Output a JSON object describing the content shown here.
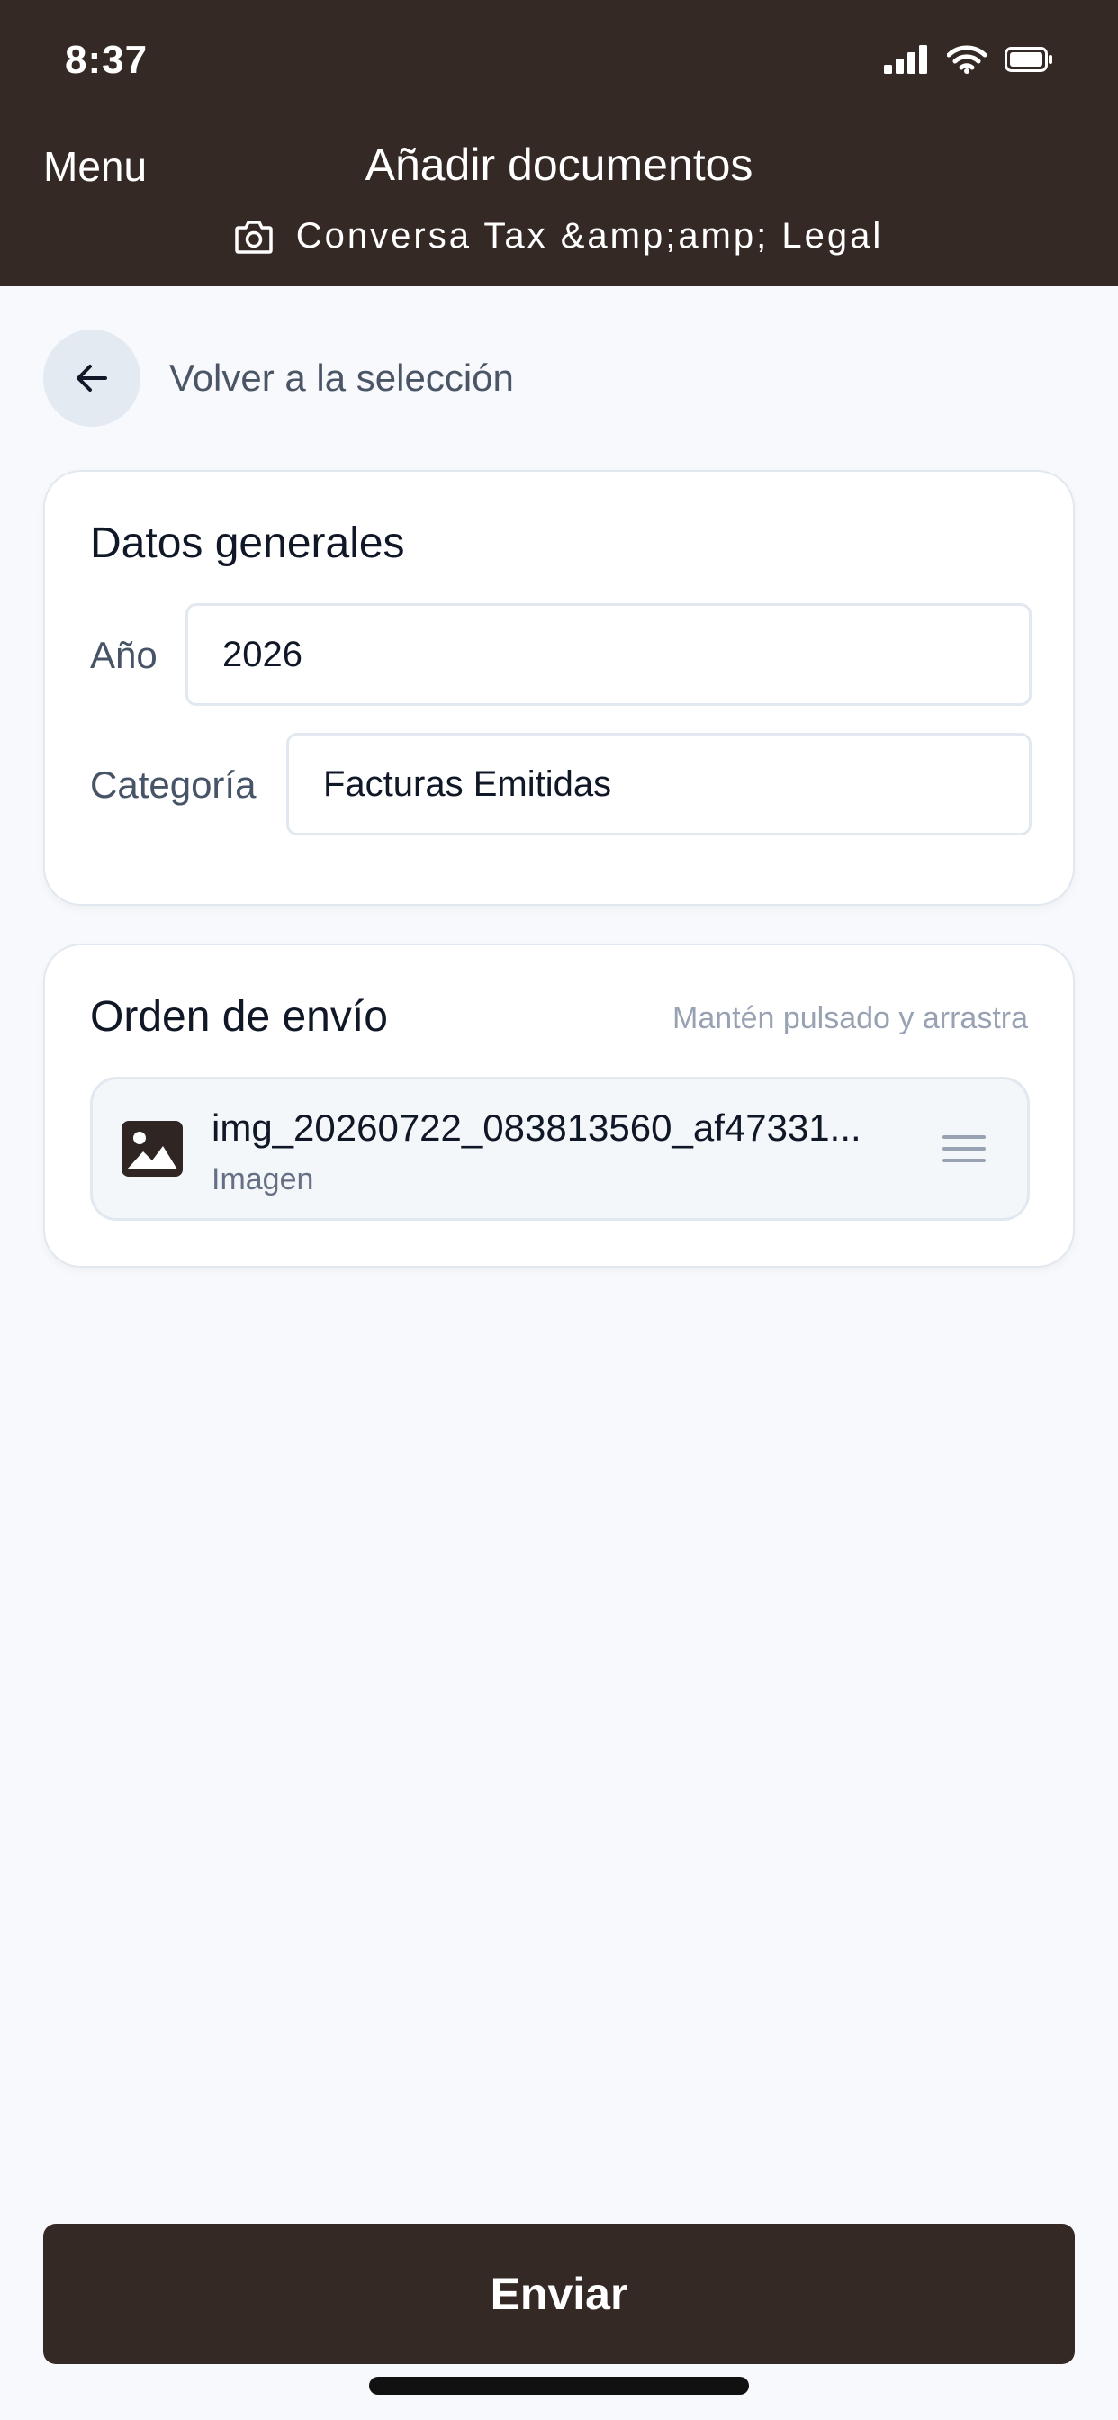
{
  "status_bar": {
    "time": "8:37"
  },
  "header": {
    "menu_label": "Menu",
    "title": "Añadir documentos",
    "subtitle": "Conversa Tax &amp;amp; Legal",
    "icon": "camera-icon"
  },
  "back": {
    "label": "Volver a la selección",
    "icon": "arrow-left-icon"
  },
  "general": {
    "title": "Datos generales",
    "year_label": "Año",
    "year_value": "2026",
    "category_label": "Categoría",
    "category_value": "Facturas Emitidas"
  },
  "order": {
    "title": "Orden de envío",
    "hint": "Mantén pulsado y arrastra",
    "files": [
      {
        "name": "img_20260722_083813560_af47331...",
        "type": "Imagen",
        "icon": "image-icon"
      }
    ]
  },
  "submit": {
    "label": "Enviar"
  },
  "colors": {
    "brand": "#352925",
    "background": "#f7f9fc"
  }
}
